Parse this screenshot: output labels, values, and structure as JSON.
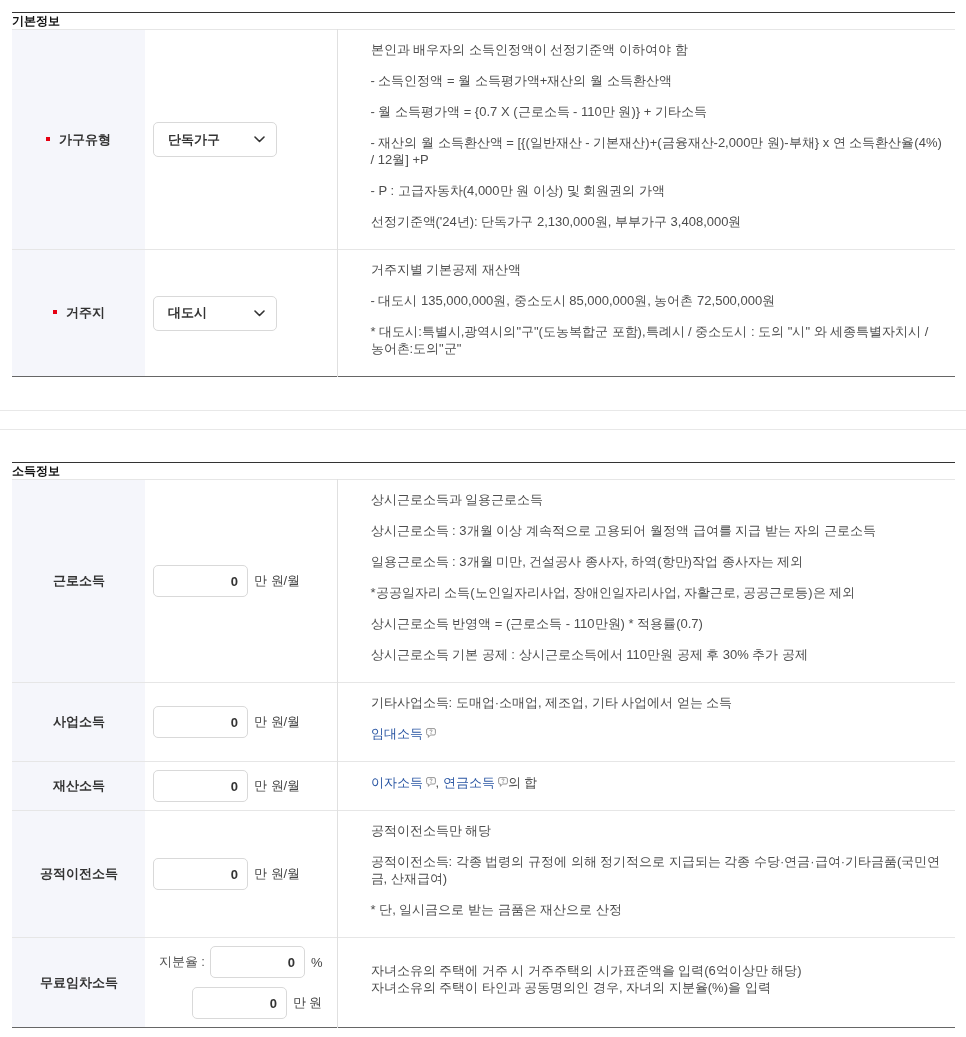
{
  "sections": [
    {
      "title": "기본정보",
      "rows": [
        {
          "label": "가구유형",
          "required": true,
          "controls": [
            {
              "kind": "select",
              "value": "단독가구"
            }
          ],
          "description": [
            {
              "text": "본인과 배우자의 소득인정액이 선정기준액 이하여야 함"
            },
            {
              "text": "- 소득인정액 = 월 소득평가액+재산의 월 소득환산액"
            },
            {
              "text": "- 월 소득평가액 = {0.7 X (근로소득 - 110만 원)} + 기타소득"
            },
            {
              "text": "- 재산의 월 소득환산액 = [{(일반재산 - 기본재산)+(금융재산-2,000만 원)-부채} x 연 소득환산율(4%) / 12월] +P"
            },
            {
              "text": "- P : 고급자동차(4,000만 원 이상) 및 회원권의 가액"
            },
            {
              "text": "선정기준액('24년): 단독가구 2,130,000원, 부부가구 3,408,000원"
            }
          ]
        },
        {
          "label": "거주지",
          "required": true,
          "controls": [
            {
              "kind": "select",
              "value": "대도시"
            }
          ],
          "description": [
            {
              "text": "거주지별 기본공제 재산액"
            },
            {
              "text": "- 대도시 135,000,000원, 중소도시 85,000,000원, 농어촌 72,500,000원"
            },
            {
              "text": "* 대도시:특별시,광역시의\"구\"(도농복합군 포함),특례시 / 중소도시 : 도의 \"시\" 와 세종특별자치시 / 농어촌:도의\"군\""
            }
          ]
        }
      ]
    },
    {
      "title": "소득정보",
      "rows": [
        {
          "label": "근로소득",
          "required": false,
          "controls": [
            {
              "kind": "input",
              "value": "0",
              "unit": "만 원/월"
            }
          ],
          "description": [
            {
              "text": "상시근로소득과 일용근로소득"
            },
            {
              "text": "상시근로소득 : 3개월 이상 계속적으로 고용되어 월정액 급여를 지급 받는 자의 근로소득"
            },
            {
              "text": "일용근로소득 : 3개월 미만, 건설공사 종사자, 하역(항만)작업 종사자는 제외"
            },
            {
              "text": "*공공일자리 소득(노인일자리사업, 장애인일자리사업, 자활근로, 공공근로등)은 제외"
            },
            {
              "text": "상시근로소득 반영액 = (근로소득 - 110만원) * 적용률(0.7)"
            },
            {
              "text": "상시근로소득 기본 공제 : 상시근로소득에서 110만원 공제 후 30% 추가 공제"
            }
          ]
        },
        {
          "label": "사업소득",
          "required": false,
          "controls": [
            {
              "kind": "input",
              "value": "0",
              "unit": "만 원/월"
            }
          ],
          "description": [
            {
              "text": "기타사업소득: 도매업·소매업, 제조업, 기타 사업에서 얻는 소득"
            },
            {
              "parts": [
                {
                  "kind": "link",
                  "text": "임대소득",
                  "help": true
                }
              ]
            }
          ]
        },
        {
          "label": "재산소득",
          "required": false,
          "controls": [
            {
              "kind": "input",
              "value": "0",
              "unit": "만 원/월"
            }
          ],
          "description": [
            {
              "parts": [
                {
                  "kind": "link",
                  "text": "이자소득",
                  "help": true
                },
                {
                  "kind": "text",
                  "text": ", "
                },
                {
                  "kind": "link",
                  "text": "연금소득",
                  "help": true
                },
                {
                  "kind": "text",
                  "text": "의 합"
                }
              ]
            }
          ]
        },
        {
          "label": "공적이전소득",
          "required": false,
          "controls": [
            {
              "kind": "input",
              "value": "0",
              "unit": "만 원/월"
            }
          ],
          "description": [
            {
              "text": "공적이전소득만 해당"
            },
            {
              "text": "공적이전소득: 각종 법령의 규정에 의해 정기적으로 지급되는 각종 수당·연금·급여·기타금품(국민연금, 산재급여)"
            },
            {
              "text": "* 단, 일시금으로 받는 금품은 재산으로 산정"
            }
          ]
        },
        {
          "label": "무료임차소득",
          "required": false,
          "controls": [
            {
              "kind": "input",
              "prefix": "지분율 :",
              "value": "0",
              "unit": "%"
            },
            {
              "kind": "input",
              "value": "0",
              "unit": "만 원"
            }
          ],
          "description": [
            {
              "lines": [
                "자녀소유의 주택에 거주 시 거주주택의 시가표준액을 입력(6억이상만 해당)",
                "자녀소유의 주택이 타인과 공동명의인 경우, 자녀의 지분율(%)을 입력"
              ]
            }
          ]
        }
      ]
    }
  ]
}
